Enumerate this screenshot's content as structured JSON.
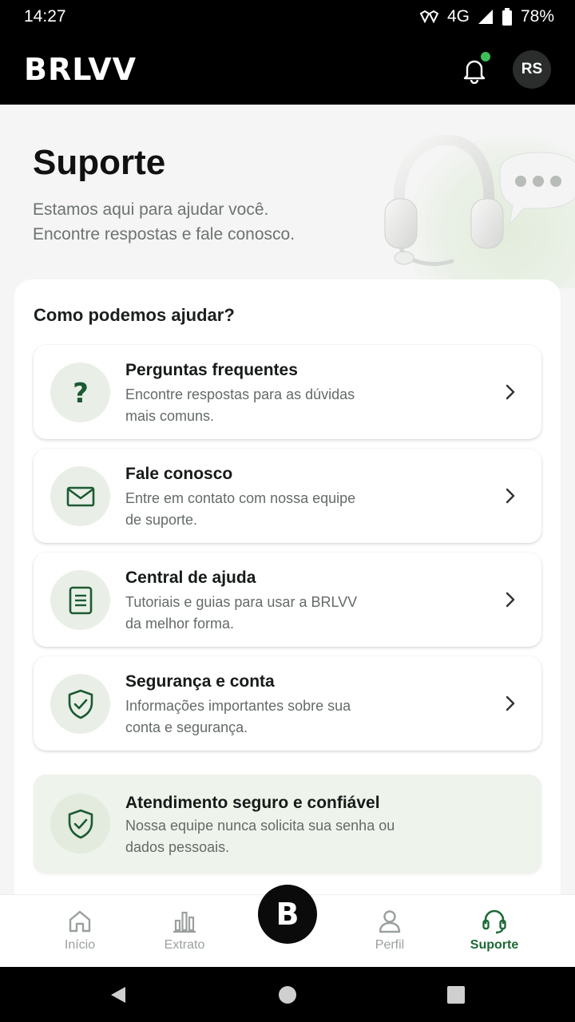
{
  "status_bar": {
    "time": "14:27",
    "network": "4G",
    "battery": "78%"
  },
  "header": {
    "logo": "BRLVV",
    "avatar_initials": "RS",
    "has_notification": true,
    "accent_color": "#3fbf5a"
  },
  "hero": {
    "title": "Suporte",
    "subtitle_line1": "Estamos aqui para ajudar você.",
    "subtitle_line2": "Encontre respostas e fale conosco."
  },
  "help": {
    "title": "Como podemos ajudar?",
    "options": [
      {
        "icon": "question-icon",
        "title": "Perguntas frequentes",
        "desc_line1": "Encontre respostas para as dúvidas",
        "desc_line2": "mais comuns."
      },
      {
        "icon": "mail-icon",
        "title": "Fale conosco",
        "desc_line1": "Entre em contato com nossa equipe",
        "desc_line2": "de suporte."
      },
      {
        "icon": "document-icon",
        "title": "Central de ajuda",
        "desc_line1": "Tutoriais e guias para usar a BRLVV",
        "desc_line2": "da melhor forma."
      },
      {
        "icon": "shield-check-icon",
        "title": "Segurança e conta",
        "desc_line1": "Informações importantes sobre sua",
        "desc_line2": "conta e segurança."
      }
    ],
    "trust": {
      "icon": "shield-check-icon",
      "title": "Atendimento seguro e confiável",
      "desc_line1": "Nossa equipe nunca solicita sua senha ou",
      "desc_line2": "dados pessoais."
    }
  },
  "bottom_nav": {
    "items": [
      {
        "icon": "home-icon",
        "label": "Início"
      },
      {
        "icon": "bar-chart-icon",
        "label": "Extrato"
      },
      {
        "icon": "brand-b-icon",
        "label": "B"
      },
      {
        "icon": "person-icon",
        "label": "Perfil"
      },
      {
        "icon": "headset-icon",
        "label": "Suporte"
      }
    ],
    "active": "Suporte",
    "active_color": "#1c6a34"
  }
}
